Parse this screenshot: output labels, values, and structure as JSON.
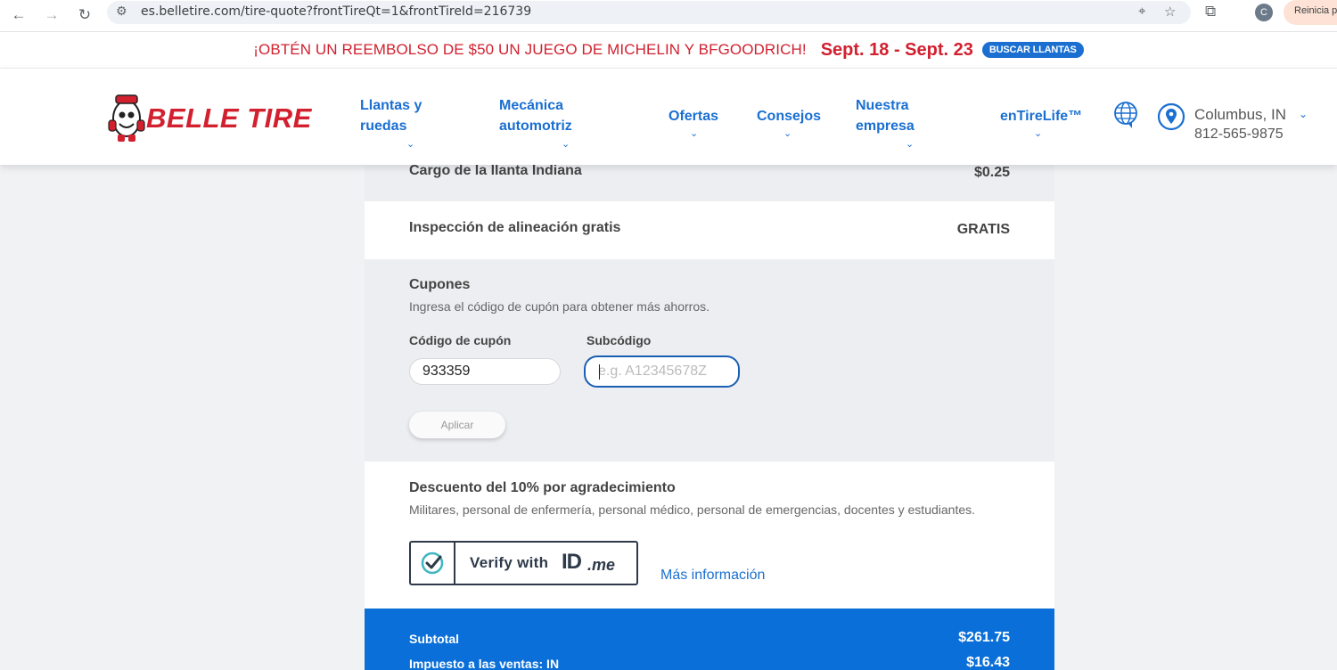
{
  "browser": {
    "url": "es.belletire.com/tire-quote?frontTireQt=1&frontTireId=216739",
    "avatar_letter": "C",
    "restart_label": "Reinicia p"
  },
  "promo": {
    "text": "¡OBTÉN UN REEMBOLSO DE $50 UN JUEGO DE MICHELIN Y BFGOODRICH!",
    "dates": "Sept. 18 - Sept. 23",
    "button": "BUSCAR LLANTAS"
  },
  "header": {
    "logo_text": "BELLE TIRE",
    "nav": [
      {
        "line1": "Llantas y",
        "line2": "ruedas"
      },
      {
        "line1": "Mecánica",
        "line2": "automotriz"
      },
      {
        "line1": "Ofertas",
        "line2": ""
      },
      {
        "line1": "Consejos",
        "line2": ""
      },
      {
        "line1": "Nuestra",
        "line2": "empresa"
      },
      {
        "line1": "enTireLife™",
        "line2": ""
      }
    ],
    "location": {
      "city": "Columbus, IN",
      "phone": "812-565-9875"
    }
  },
  "quote": {
    "tire_fee_label": "Cargo de la llanta Indiana",
    "tire_fee_value": "$0.25",
    "alignment_label": "Inspección de alineación gratis",
    "alignment_value": "GRATIS",
    "coupons": {
      "title": "Cupones",
      "description": "Ingresa el código de cupón para obtener más ahorros.",
      "code_label": "Código de cupón",
      "code_value": "933359",
      "subcode_label": "Subcódigo",
      "subcode_placeholder": "e.g. A12345678Z",
      "apply_label": "Aplicar"
    },
    "discount": {
      "title": "Descuento del 10% por agradecimiento",
      "description": "Militares, personal de enfermería, personal médico, personal de emergencias, docentes y estudiantes.",
      "verify_label": "Verify with",
      "brand_id": "ID",
      "brand_me": ".me",
      "more_info": "Más información"
    },
    "totals": {
      "subtotal_label": "Subtotal",
      "subtotal_value": "$261.75",
      "tax_label": "Impuesto a las ventas: IN",
      "tax_value": "$16.43"
    }
  },
  "colors": {
    "brand_red": "#d2202f",
    "link_blue": "#1a6fd1",
    "totals_blue": "#0a6fd8"
  }
}
